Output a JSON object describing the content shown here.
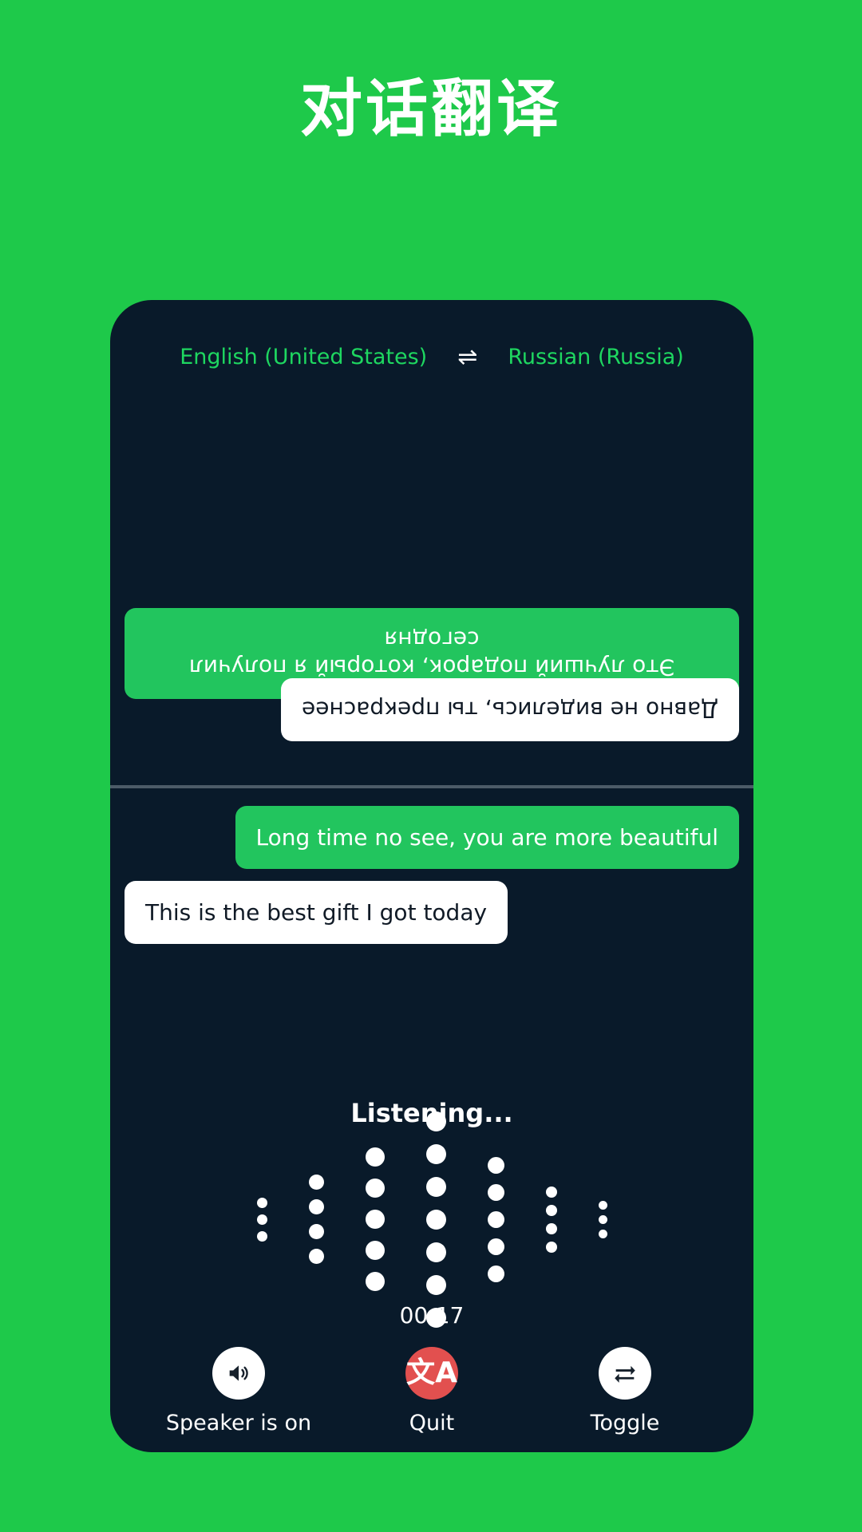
{
  "page": {
    "title": "对话翻译",
    "background_color": "#1ec94a",
    "card_color": "#091a2a"
  },
  "language_bar": {
    "source_language": "English (United States)",
    "swap_icon": "swap-horizontal-icon",
    "swap_glyph": "⇌",
    "target_language": "Russian (Russia)",
    "text_color": "#1ed760"
  },
  "conversation": {
    "top_panel": {
      "orientation": "rotated-180",
      "messages": [
        {
          "text": "Это лучший подарок, который я получил сегодня",
          "style": "green",
          "align": "full"
        },
        {
          "text": "Давно не виделись, ты прекраснее",
          "style": "white",
          "align": "right"
        }
      ]
    },
    "bottom_panel": {
      "orientation": "normal",
      "messages": [
        {
          "text": "Long time no see, you are more beautiful",
          "style": "green",
          "align": "right"
        },
        {
          "text": "This is the best gift I got today",
          "style": "white",
          "align": "left"
        }
      ]
    }
  },
  "status": {
    "listening_label": "Listening...",
    "timer": "00:17"
  },
  "waveform": {
    "columns": [
      {
        "dots": 3,
        "size": 13
      },
      {
        "dots": 4,
        "size": 19
      },
      {
        "dots": 5,
        "size": 24
      },
      {
        "dots": 7,
        "size": 25
      },
      {
        "dots": 5,
        "size": 21
      },
      {
        "dots": 4,
        "size": 14
      },
      {
        "dots": 3,
        "size": 11
      }
    ],
    "dot_color": "#ffffff"
  },
  "controls": [
    {
      "label": "Speaker is on",
      "icon": "speaker-on-icon",
      "circle": "light"
    },
    {
      "label": "Quit",
      "icon": "translate-icon",
      "circle": "danger",
      "glyph": "文A"
    },
    {
      "label": "Toggle",
      "icon": "swap-repeat-icon",
      "circle": "light"
    }
  ],
  "colors": {
    "brand_green": "#1ec94a",
    "bubble_green": "#22c55e",
    "quit_red": "#e2504f",
    "card_dark": "#091a2a",
    "divider": "#4c5b68"
  }
}
